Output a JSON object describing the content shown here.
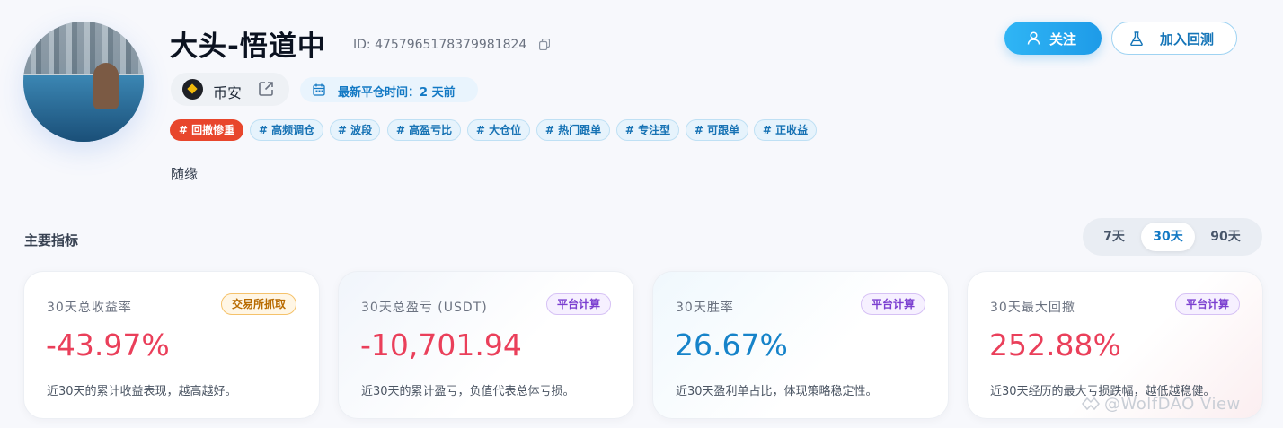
{
  "profile": {
    "name": "大头-悟道中",
    "uid": "ID: 4757965178379981824",
    "exchange": "币安",
    "latest_close": "最新平仓时间：2 天前",
    "bio": "随缘",
    "tags": [
      "# 回撤惨重",
      "# 高频调仓",
      "# 波段",
      "# 高盈亏比",
      "# 大仓位",
      "# 热门跟单",
      "# 专注型",
      "# 可跟单",
      "# 正收益"
    ]
  },
  "actions": {
    "follow_label": "关注",
    "backtest_label": "加入回测"
  },
  "metrics": {
    "section_title": "主要指标",
    "ranges": [
      "7天",
      "30天",
      "90天"
    ],
    "active_range": "30天",
    "cards": [
      {
        "label": "30天总收益率",
        "badge": "交易所抓取",
        "value": "-43.97%",
        "desc": "近30天的累计收益表现，越高越好。"
      },
      {
        "label": "30天总盈亏 (USDT)",
        "badge": "平台计算",
        "value": "-10,701.94",
        "desc": "近30天的累计盈亏，负值代表总体亏损。"
      },
      {
        "label": "30天胜率",
        "badge": "平台计算",
        "value": "26.67%",
        "desc": "近30天盈利单占比，体现策略稳定性。"
      },
      {
        "label": "30天最大回撤",
        "badge": "平台计算",
        "value": "252.88%",
        "desc": "近30天经历的最大亏损跌幅，越低越稳健。"
      }
    ]
  },
  "watermark": "@WolfDAO View",
  "colors": {
    "accent": "#1e9be8",
    "negative": "#ea3f5a",
    "positive_blue": "#1683c9",
    "hot_tag": "#e8462c"
  }
}
